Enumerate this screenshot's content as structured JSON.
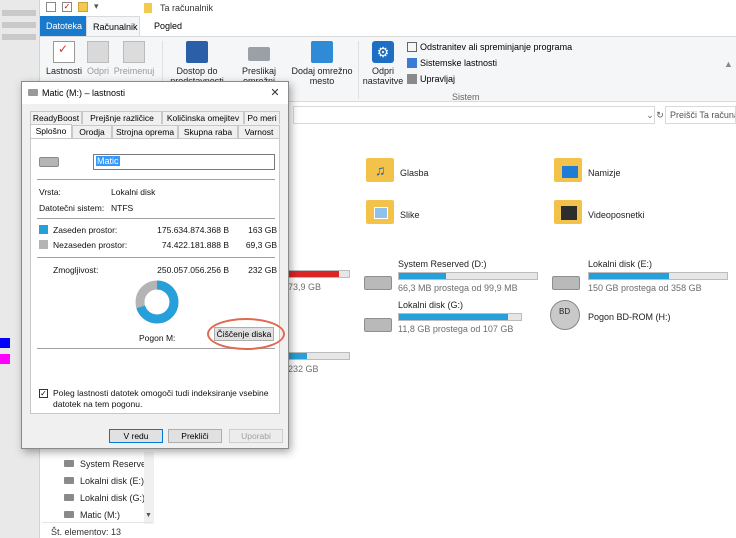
{
  "explorer": {
    "title": "Ta računalnik",
    "tabs": {
      "file": "Datoteka",
      "computer": "Računalnik",
      "view": "Pogled"
    },
    "ribbon": {
      "properties": "Lastnosti",
      "open": "Odpri",
      "rename": "Preimenuj",
      "access_media": [
        "Dostop do",
        "predstavnosti"
      ],
      "map_drive": [
        "Preslikaj omrežni",
        "pogon"
      ],
      "add_location": [
        "Dodaj omrežno",
        "mesto"
      ],
      "open_settings": [
        "Odpri",
        "nastavitve"
      ],
      "uninstall": "Odstranitev ali spreminjanje programa",
      "system_properties": "Sistemske lastnosti",
      "manage": "Upravljaj",
      "system_group": "Sistem"
    },
    "search_placeholder": "Preišči Ta računalnik",
    "folders": [
      {
        "name": "Glasba"
      },
      {
        "name": "Namizje"
      },
      {
        "name": "Slike"
      },
      {
        "name": "Videoposnetki"
      }
    ],
    "drives": [
      {
        "name": "",
        "free": "73,9 GB",
        "fill": 0.84,
        "color": "#da2626"
      },
      {
        "name": "System Reserved (D:)",
        "free": "66,3 MB prostega od 99,9 MB",
        "fill": 0.34,
        "color": "#26a0da"
      },
      {
        "name": "Lokalni disk (E:)",
        "free": "150 GB prostega od 358 GB",
        "fill": 0.58,
        "color": "#26a0da"
      },
      {
        "name": "Lokalni disk (G:)",
        "free": "11,8 GB prostega od 107 GB",
        "fill": 0.89,
        "color": "#26a0da"
      },
      {
        "name": "Pogon BD-ROM (H:)"
      },
      {
        "name": "",
        "free": "232 GB",
        "fill": 0.3,
        "color": "#26a0da"
      }
    ],
    "nav_items": [
      "System Reserved",
      "Lokalni disk (E:)",
      "Lokalni disk (G:)",
      "Matic (M:)"
    ],
    "status": "Št. elementov: 13",
    "colors": {
      "accent": "#1979ca",
      "used": "#26a0da",
      "free": "#bcbcbc"
    }
  },
  "dialog": {
    "title": "Matic (M:) – lastnosti",
    "tabs_row1": [
      "ReadyBoost",
      "Prejšnje različice",
      "Količinska omejitev",
      "Po meri"
    ],
    "tabs_row2": [
      "Splošno",
      "Orodja",
      "Strojna oprema",
      "Skupna raba",
      "Varnost"
    ],
    "name_value": "Matic",
    "type_label": "Vrsta:",
    "type_value": "Lokalni disk",
    "fs_label": "Datotečni sistem:",
    "fs_value": "NTFS",
    "used_label": "Zaseden prostor:",
    "used_bytes": "175.634.874.368 B",
    "used_gb": "163 GB",
    "free_label": "Nezaseden prostor:",
    "free_bytes": "74.422.181.888 B",
    "free_gb": "69,3 GB",
    "cap_label": "Zmogljivost:",
    "cap_bytes": "250.057.056.256 B",
    "cap_gb": "232 GB",
    "drive_label": "Pogon M:",
    "cleanup": "Čiščenje diska",
    "used_fraction": 0.702,
    "index_text": [
      "Poleg lastnosti datotek omogoči tudi indeksiranje vsebine",
      "datotek na tem pogonu."
    ],
    "ok": "V redu",
    "cancel": "Prekliči",
    "apply": "Uporabi"
  }
}
